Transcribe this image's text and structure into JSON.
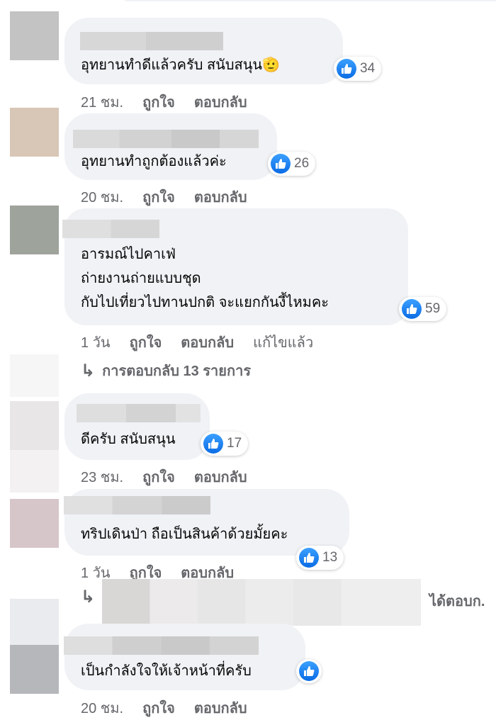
{
  "comments": [
    {
      "text_lines": [
        "อุทยานทำดีแล้วครับ สนับสนุน🫡"
      ],
      "likes": "34",
      "meta": {
        "time": "21 ชม.",
        "like": "ถูกใจ",
        "reply": "ตอบกลับ"
      }
    },
    {
      "text_lines": [
        "อุทยานทำถูกต้องแล้วค่ะ"
      ],
      "likes": "26",
      "meta": {
        "time": "20 ชม.",
        "like": "ถูกใจ",
        "reply": "ตอบกลับ"
      }
    },
    {
      "text_lines": [
        "อารมณ์ไปคาเฟ่",
        "ถ่ายงานถ่ายแบบชุด",
        "กับไปเที่ยวไปทานปกติ จะแยกกันงี้ไหมคะ"
      ],
      "likes": "59",
      "meta": {
        "time": "1 วัน",
        "like": "ถูกใจ",
        "reply": "ตอบกลับ",
        "edited": "แก้ไขแล้ว"
      },
      "replies_link": "การตอบกลับ 13 รายการ"
    },
    {
      "text_lines": [
        "ดีครับ สนับสนุน"
      ],
      "likes": "17",
      "meta": {
        "time": "23 ชม.",
        "like": "ถูกใจ",
        "reply": "ตอบกลับ"
      }
    },
    {
      "text_lines": [
        "ทริปเดินป่า ถือเป็นสินค้าด้วยมั้ยคะ"
      ],
      "likes": "13",
      "meta": {
        "time": "1 วัน",
        "like": "ถูกใจ",
        "reply": "ตอบกลับ"
      },
      "reply_preview_suffix": "ได้ตอบก."
    },
    {
      "text_lines": [
        "เป็นกำลังใจให้เจ้าหน้าที่ครับ"
      ],
      "likes": "",
      "meta": {
        "time": "20 ชม.",
        "like": "ถูกใจ",
        "reply": "ตอบกลับ"
      }
    }
  ],
  "icons": {
    "like": "thumbs-up-icon",
    "reply_arrow": "reply-arrow-icon"
  },
  "colors": {
    "bubble": "#f0f2f5",
    "meta_text": "#65676b",
    "like_blue": "#0a6be4",
    "blur_gray": "#d0d0d0"
  }
}
